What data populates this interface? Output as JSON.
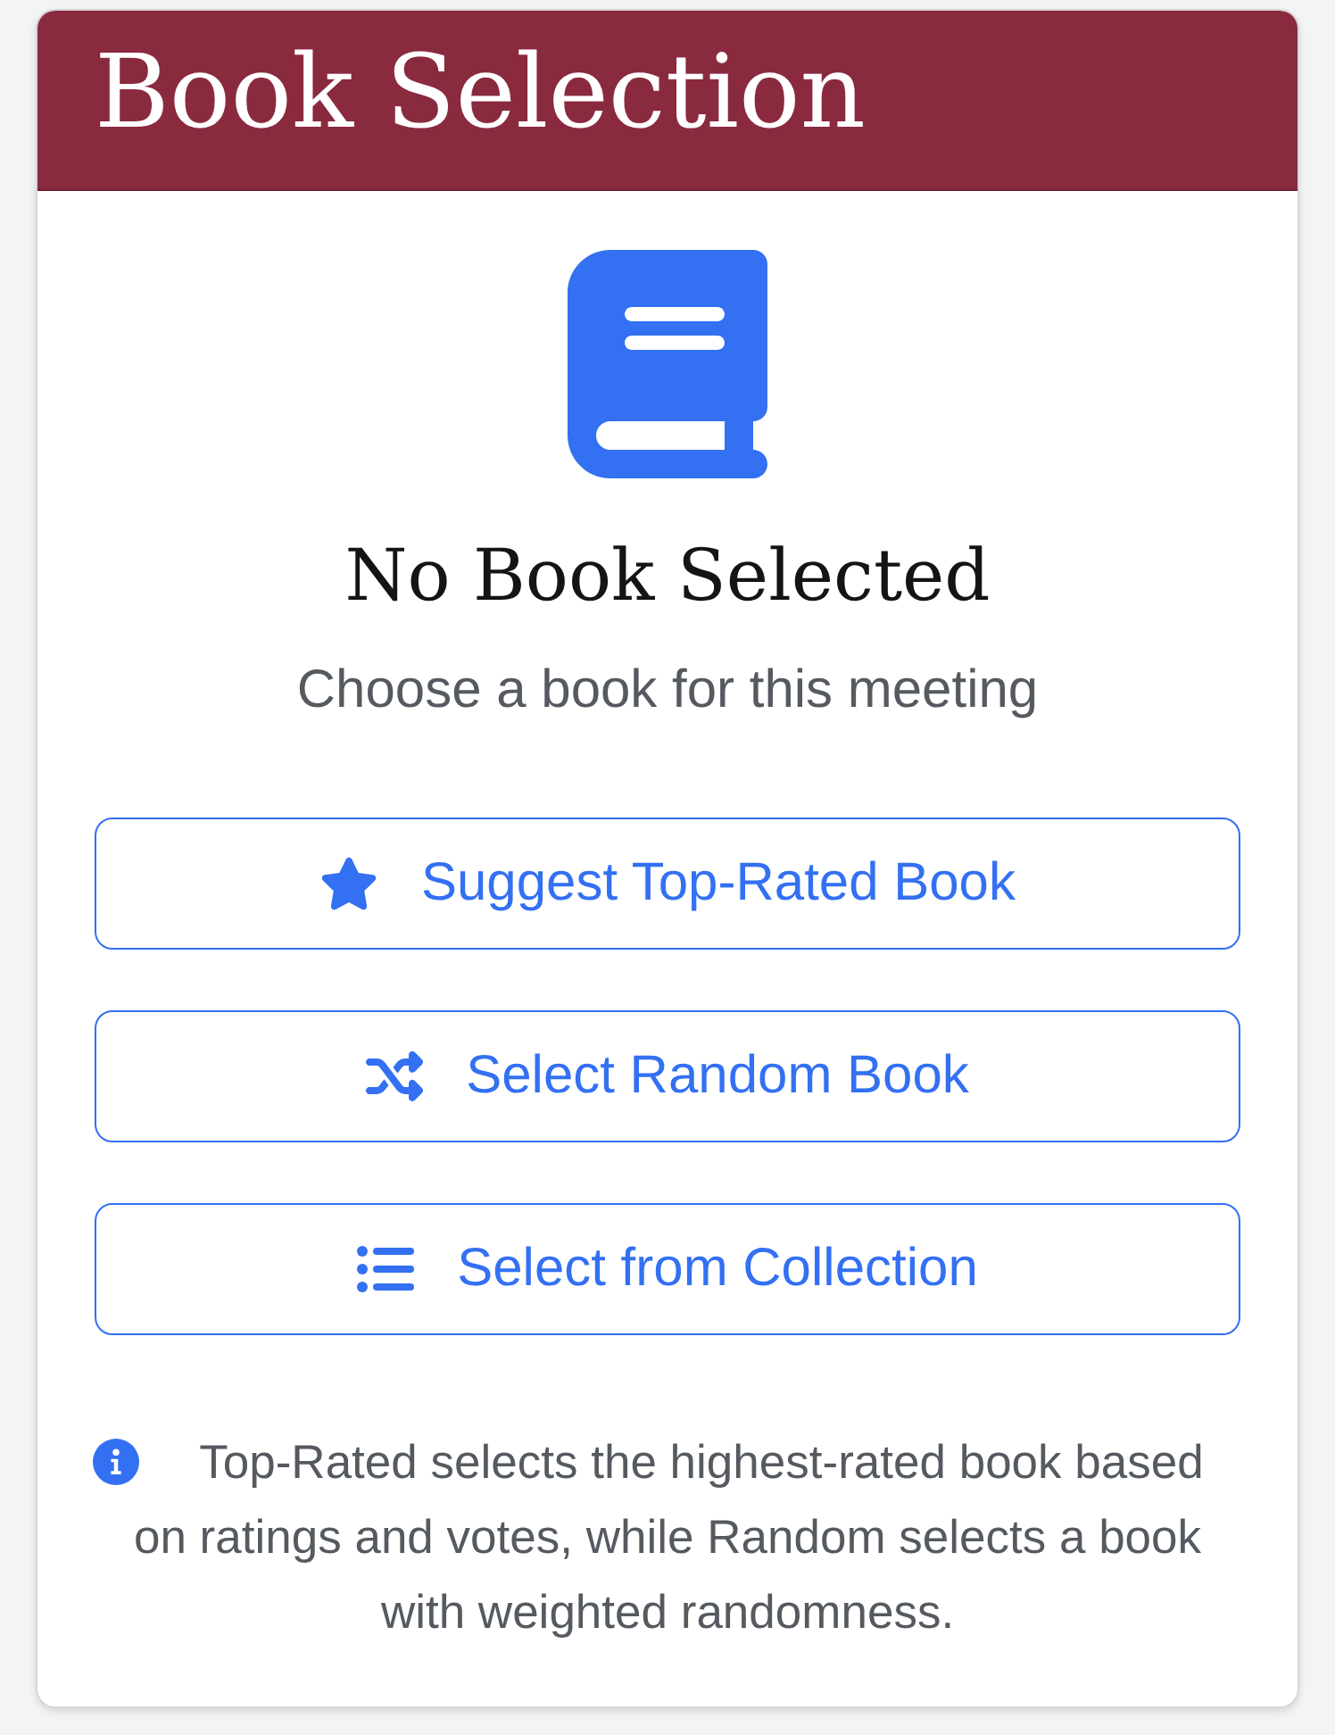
{
  "header": {
    "title": "Book Selection"
  },
  "empty_state": {
    "title": "No Book Selected",
    "subtitle": "Choose a book for this meeting"
  },
  "actions": [
    {
      "kind": "star",
      "label": "Suggest Top-Rated Book"
    },
    {
      "kind": "shuffle",
      "label": "Select Random Book"
    },
    {
      "kind": "list",
      "label": "Select from Collection"
    }
  ],
  "note": {
    "text": "Top-Rated selects the highest-rated book based on ratings and votes, while Random selects a book with weighted randomness."
  }
}
